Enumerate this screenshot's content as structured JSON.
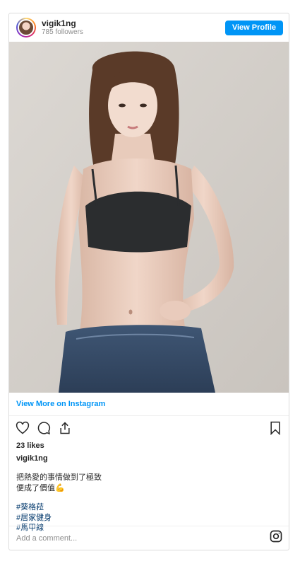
{
  "header": {
    "username": "vigik1ng",
    "followers": "785 followers",
    "view_profile_label": "View Profile"
  },
  "post": {
    "image_icon": "photo",
    "view_more_label": "View More on Instagram",
    "likes": "23 likes",
    "caption_user": "vigik1ng",
    "caption_line1": "把熱愛的事情做到了極致",
    "caption_line2": "便成了價值💪",
    "hashtags": [
      "#葵格菈",
      "#居家健身",
      "#馬甲線"
    ]
  },
  "actions": {
    "icons": [
      "heart-icon",
      "comment-icon",
      "share-icon",
      "bookmark-icon"
    ]
  },
  "comment": {
    "placeholder": "Add a comment..."
  },
  "colors": {
    "accent": "#0095f6",
    "hashtag": "#00376b",
    "muted": "#8e8e8e"
  }
}
